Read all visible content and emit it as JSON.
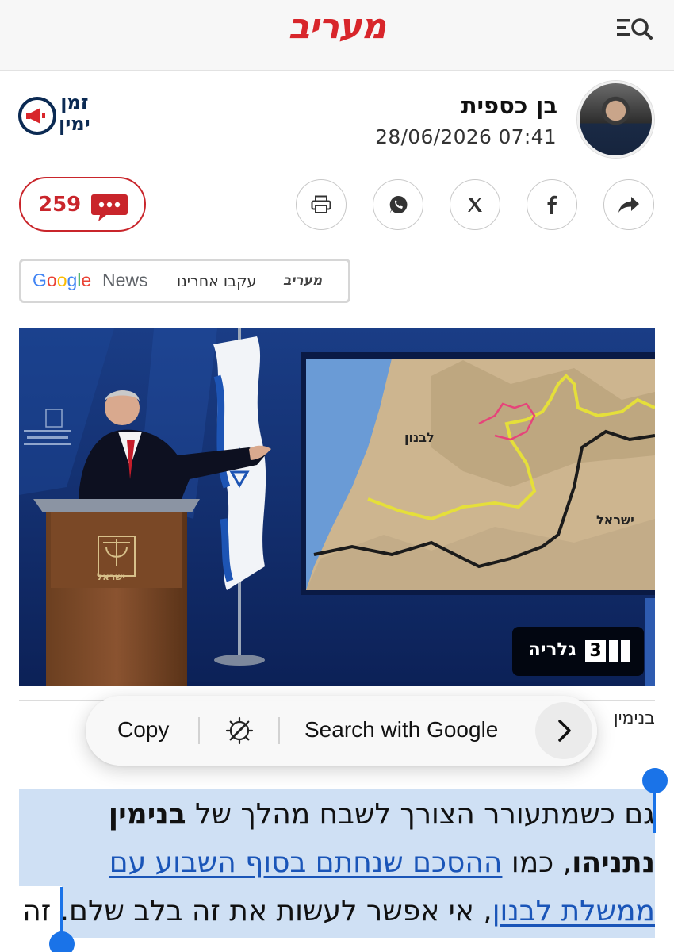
{
  "header": {
    "logo_text": "מעריב",
    "menu_icon": "search-menu-icon",
    "brand_color": "#d8262b"
  },
  "author": {
    "name": "בן כספית",
    "datetime": "28/06/2026 07:41",
    "column_badge": {
      "line1": "זמן",
      "line2": "ימין",
      "icon": "megaphone-clock-icon"
    }
  },
  "actions": {
    "comments_count": "259",
    "comments_icon": "comment-bubble-icon",
    "share_buttons": [
      {
        "icon": "share-icon"
      },
      {
        "icon": "facebook-icon"
      },
      {
        "icon": "x-icon"
      },
      {
        "icon": "whatsapp-icon"
      },
      {
        "icon": "print-icon"
      }
    ]
  },
  "google_news": {
    "brand": "מעריב",
    "follow_text": "עקבו אחרינו",
    "google_word": "Google",
    "news_word": "News"
  },
  "photo": {
    "map_label_lebanon": "לבנון",
    "map_label_israel": "ישראל",
    "podium_text": "ישראל",
    "gallery_label": "גלריה",
    "gallery_count": "3"
  },
  "caption": {
    "credit": "בנימין"
  },
  "context_menu": {
    "copy_label": "Copy",
    "search_label": "Search with Google",
    "magic_icon": "magic-wand-icon",
    "next_icon": "chevron-right-icon"
  },
  "article": {
    "line1_plain": "גם כשמתעורר הצורך לשבח מהלך של ",
    "line1_bold": "בנימין",
    "line2_bold": "נתניהו",
    "line2_plain": ", כמו ",
    "line2_link": "ההסכם שנחתם בסוף השבוע עם",
    "line3_link": "ממשלת לבנון",
    "line3_plain": ", אי אפשר לעשות את זה בלב שלם. זה",
    "selection_color": "#cfe0f4",
    "link_color": "#1a55b8"
  }
}
